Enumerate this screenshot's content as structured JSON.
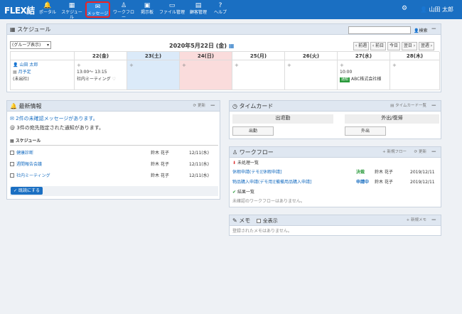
{
  "app": {
    "logo": "FLEX結"
  },
  "nav": [
    {
      "label": "ポータル",
      "icon": "bell-icon",
      "glyph": "🔔"
    },
    {
      "label": "スケジュール",
      "icon": "calendar-icon",
      "glyph": "▦"
    },
    {
      "label": "メッセージ",
      "icon": "envelope-icon",
      "glyph": "✉"
    },
    {
      "label": "ワークフロー",
      "icon": "stamp-icon",
      "glyph": "♙"
    },
    {
      "label": "掲示板",
      "icon": "board-icon",
      "glyph": "▣"
    },
    {
      "label": "ファイル管理",
      "icon": "folder-icon",
      "glyph": "▭"
    },
    {
      "label": "顧客管理",
      "icon": "book-icon",
      "glyph": "▤"
    },
    {
      "label": "ヘルプ",
      "icon": "help-icon",
      "glyph": "?"
    }
  ],
  "user": {
    "name": "山田 太郎"
  },
  "schedule": {
    "title": "スケジュール",
    "search_label": "検索",
    "group_select": "(グループ表示)",
    "date": "2020年5月22日 (金)",
    "nav_buttons": [
      "前週",
      "前日",
      "今日",
      "翌日",
      "翌週"
    ],
    "days": [
      "22(金)",
      "23(土)",
      "24(日)",
      "25(月)",
      "26(火)",
      "27(水)",
      "28(木)"
    ],
    "person": {
      "name": "山田 太郎",
      "plan": "月予定",
      "status": "(未出社)"
    },
    "events": [
      {
        "day": 0,
        "time": "13:00～ 13:15",
        "title": "社内ミーティング"
      },
      {
        "day": 5,
        "time": "10:00",
        "tag": "通知",
        "title": "ABC株式会社様"
      }
    ]
  },
  "news": {
    "title": "最新情報",
    "refresh": "更新",
    "unconfirmed_msg": "2件の未確認メッセージがあります。",
    "notice_msg": "3件の宛先指定された通知があります。",
    "section": "スケジュール",
    "items": [
      {
        "title": "健康診断",
        "person": "鈴木 花子",
        "date": "12/11(水)"
      },
      {
        "title": "週間報告会議",
        "person": "鈴木 花子",
        "date": "12/11(水)"
      },
      {
        "title": "社内ミーティング",
        "person": "鈴木 花子",
        "date": "12/11(水)"
      }
    ],
    "mark_read": "既読にする"
  },
  "timecard": {
    "title": "タイムカード",
    "list_link": "タイムカード一覧",
    "clock_in": "出退勤",
    "out_return": "外出/復帰",
    "clock_in_btn": "出勤",
    "out_btn": "外出"
  },
  "workflow": {
    "title": "ワークフロー",
    "new": "新規フロー",
    "refresh": "更新",
    "pending_label": "未処理一覧",
    "items": [
      {
        "title": "休暇申請(テモ)[休暇申請]",
        "status": "決裁",
        "person": "鈴木 花子",
        "date": "2019/12/11"
      },
      {
        "title": "物品購入申請(デモ用)[備備用品購入申請]",
        "status": "申請中",
        "person": "鈴木 花子",
        "date": "2019/12/11"
      }
    ],
    "done_label": "結果一覧",
    "empty": "未確認のワークフローはありません。"
  },
  "memo": {
    "title": "メモ",
    "show_all": "全表示",
    "new": "新規メモ",
    "empty": "登録されたメモはありません。"
  },
  "colors": {
    "primary": "#1a6fc2",
    "header_bg": "#dfe7f1",
    "saturday": "#dbeaf9",
    "sunday": "#fadcdc",
    "tag_green": "#2a9a3c"
  }
}
